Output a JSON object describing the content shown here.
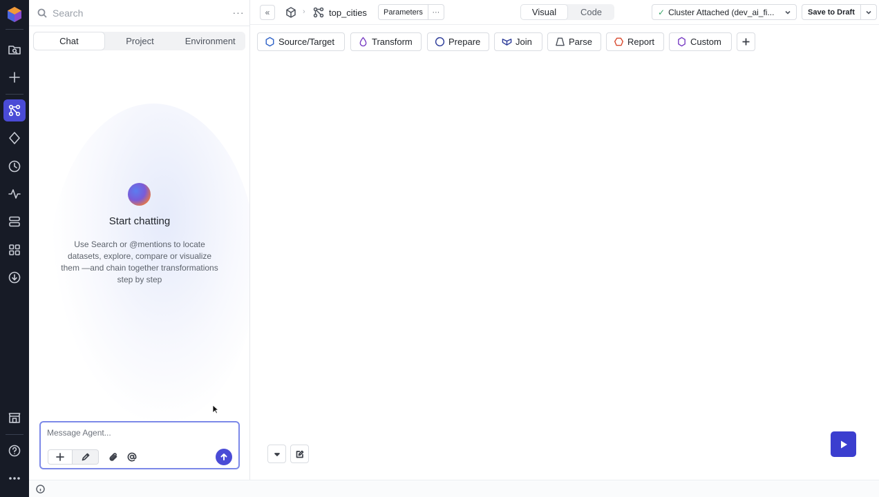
{
  "sidebar": {
    "search_placeholder": "Search",
    "more_label": "···",
    "tabs": [
      {
        "label": "Chat",
        "active": true
      },
      {
        "label": "Project",
        "active": false
      },
      {
        "label": "Environment",
        "active": false
      }
    ]
  },
  "chat": {
    "title": "Start chatting",
    "description": "Use Search or @mentions to locate datasets, explore, compare or visualize them —and chain together transformations step by step",
    "input_placeholder": "Message Agent...",
    "actions": [
      "plus-icon",
      "pencil-icon",
      "paperclip-icon",
      "at-icon",
      "send-arrow-icon"
    ]
  },
  "header": {
    "collapse_label": "«",
    "breadcrumb_separator": "›",
    "pipeline_name": "top_cities",
    "parameters_label": "Parameters",
    "parameters_more": "···",
    "view_options": [
      {
        "label": "Visual",
        "active": true
      },
      {
        "label": "Code",
        "active": false
      }
    ],
    "cluster_status": "Cluster Attached (dev_ai_fi...",
    "cluster_check": "✓",
    "save_label": "Save to Draft"
  },
  "gems": [
    {
      "label": "Source/Target",
      "icon": "hexagon-icon",
      "color": "#2f62c7"
    },
    {
      "label": "Transform",
      "icon": "droplet-icon",
      "color": "#7a3fc4"
    },
    {
      "label": "Prepare",
      "icon": "circle-icon",
      "color": "#2c3b99"
    },
    {
      "label": "Join",
      "icon": "join-icon",
      "color": "#2c3b99"
    },
    {
      "label": "Parse",
      "icon": "trapezoid-icon",
      "color": "#4c525c"
    },
    {
      "label": "Report",
      "icon": "report-icon",
      "color": "#d8492e"
    },
    {
      "label": "Custom",
      "icon": "custom-hexagon-icon",
      "color": "#7a3fc4"
    }
  ],
  "colors": {
    "rail_bg": "#171b26",
    "accent": "#4a4bd6",
    "run_button": "#3b3ecf"
  }
}
